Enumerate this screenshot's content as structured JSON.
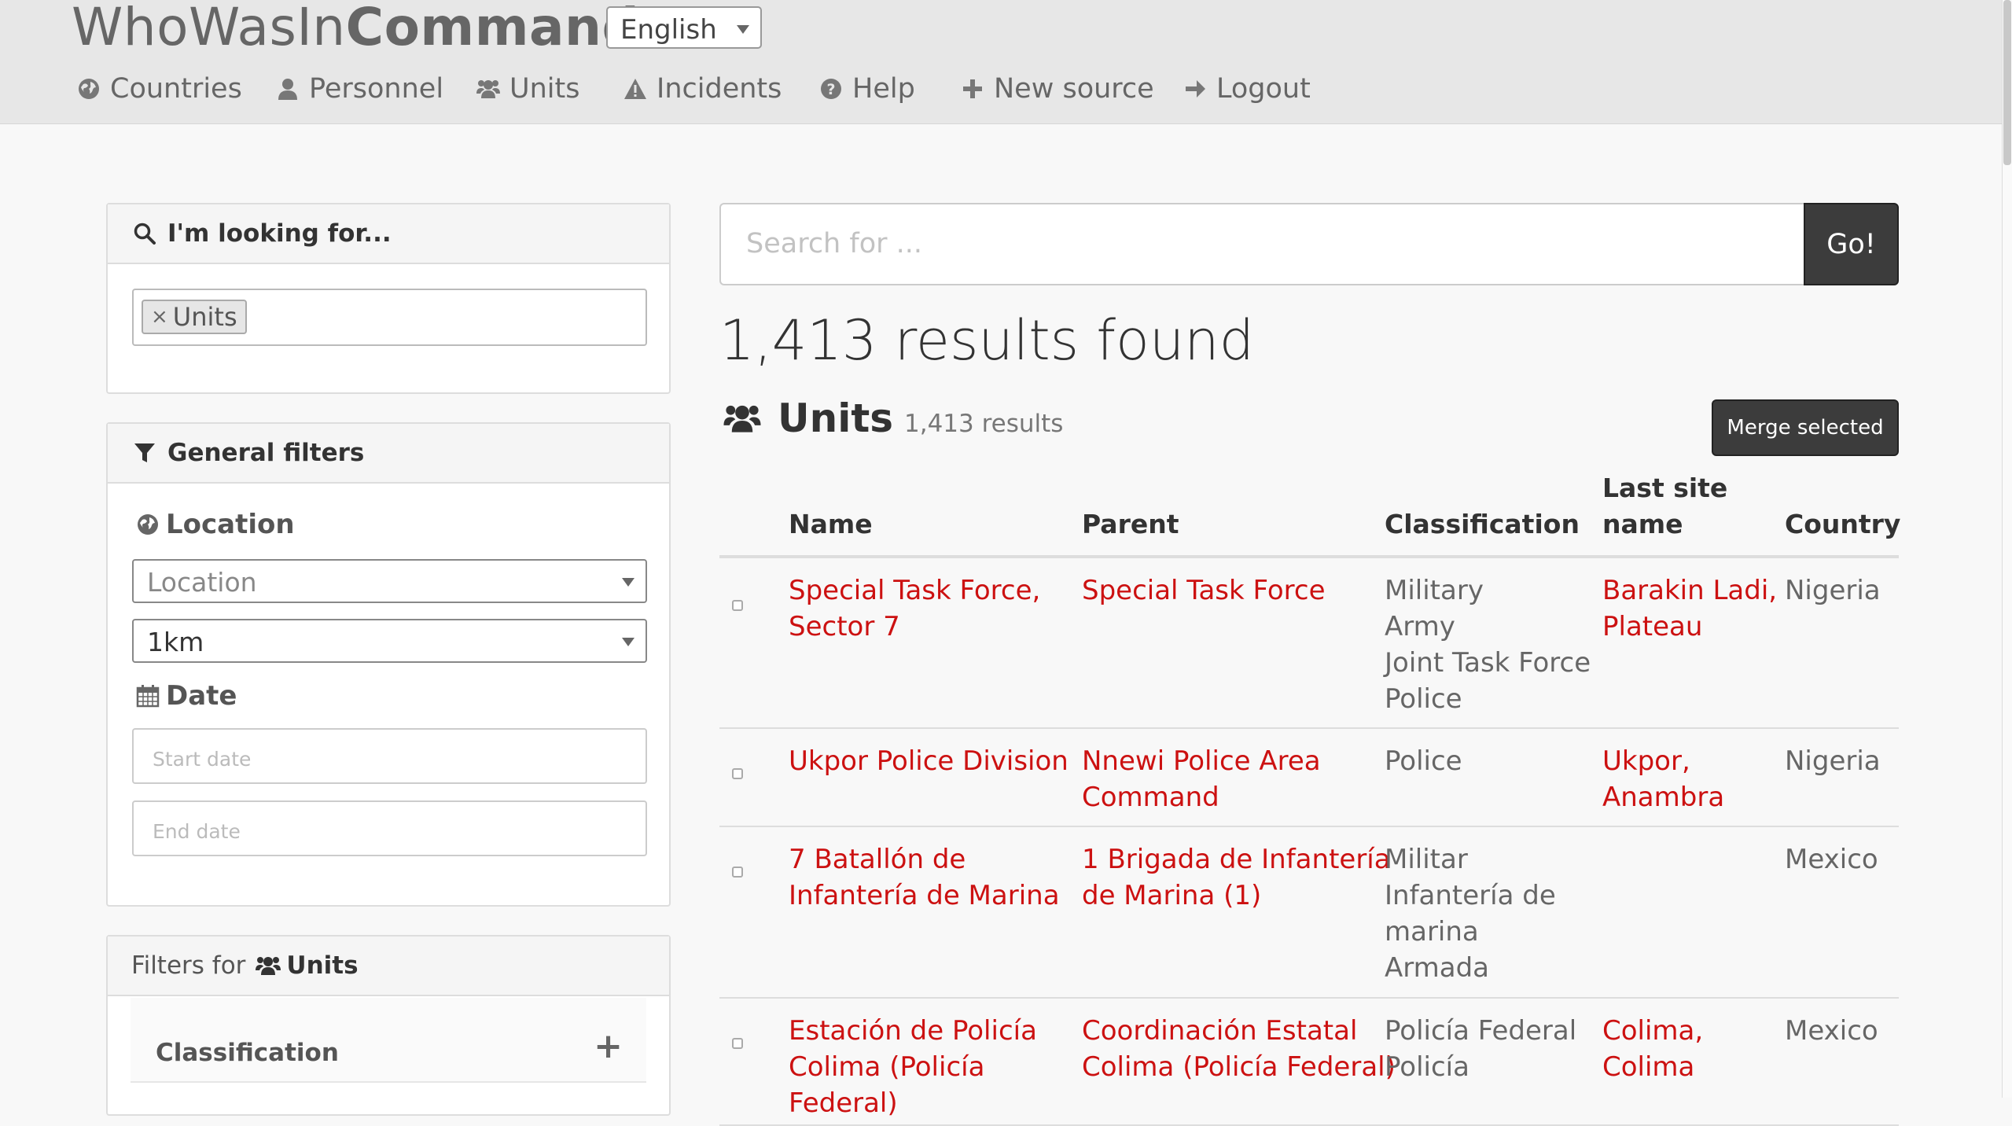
{
  "brand": {
    "light": "WhoWasIn",
    "bold": "Command"
  },
  "language": {
    "selected": "English"
  },
  "nav": [
    {
      "label": "Countries",
      "icon": "globe-icon"
    },
    {
      "label": "Personnel",
      "icon": "user-icon"
    },
    {
      "label": "Units",
      "icon": "users-icon"
    },
    {
      "label": "Incidents",
      "icon": "warning-icon"
    },
    {
      "label": "Help",
      "icon": "question-circle-icon"
    },
    {
      "label": "New source",
      "icon": "plus-icon"
    },
    {
      "label": "Logout",
      "icon": "arrow-right-icon"
    }
  ],
  "sidebar": {
    "looking_for": {
      "title": "I'm looking for...",
      "tag_remove": "×",
      "tag": "Units"
    },
    "general": {
      "title": "General filters",
      "location_label": "Location",
      "location_placeholder": "Location",
      "radius": "1km",
      "date_label": "Date",
      "start_placeholder": "Start date",
      "end_placeholder": "End date"
    },
    "entity_filters": {
      "prefix": "Filters for",
      "entity": "Units",
      "classification": "Classification",
      "expand": "+"
    }
  },
  "search": {
    "placeholder": "Search for ...",
    "button": "Go!"
  },
  "results": {
    "count_text": "1,413 results found",
    "section_title": "Units",
    "section_count": "1,413 results",
    "merge_button": "Merge selected"
  },
  "table": {
    "headers": {
      "name": "Name",
      "parent": "Parent",
      "classification": "Classification",
      "site_line1": "Last site",
      "site_line2": "name",
      "country": "Country"
    },
    "rows": [
      {
        "name": [
          "Special Task Force,",
          "Sector 7"
        ],
        "parent": [
          "Special Task Force"
        ],
        "classification": [
          "Military",
          "Army",
          "Joint Task Force",
          "Police"
        ],
        "site": [
          "Barakin Ladi,",
          "Plateau"
        ],
        "country": "Nigeria"
      },
      {
        "name": [
          "Ukpor Police Division"
        ],
        "parent": [
          "Nnewi Police Area",
          "Command"
        ],
        "classification": [
          "Police"
        ],
        "site": [
          "Ukpor,",
          "Anambra"
        ],
        "country": "Nigeria"
      },
      {
        "name": [
          "7 Batallón de",
          "Infantería de Marina"
        ],
        "parent": [
          "1 Brigada de Infantería",
          "de Marina (1)"
        ],
        "classification": [
          "Militar",
          "Infantería de",
          "marina",
          "Armada"
        ],
        "site": [],
        "country": "Mexico"
      },
      {
        "name": [
          "Estación de Policía",
          "Colima (Policía",
          "Federal)"
        ],
        "parent": [
          "Coordinación Estatal",
          "Colima (Policía Federal)"
        ],
        "classification": [
          "Policía Federal",
          "Policía"
        ],
        "site": [
          "Colima,",
          "Colima"
        ],
        "country": "Mexico"
      }
    ]
  }
}
